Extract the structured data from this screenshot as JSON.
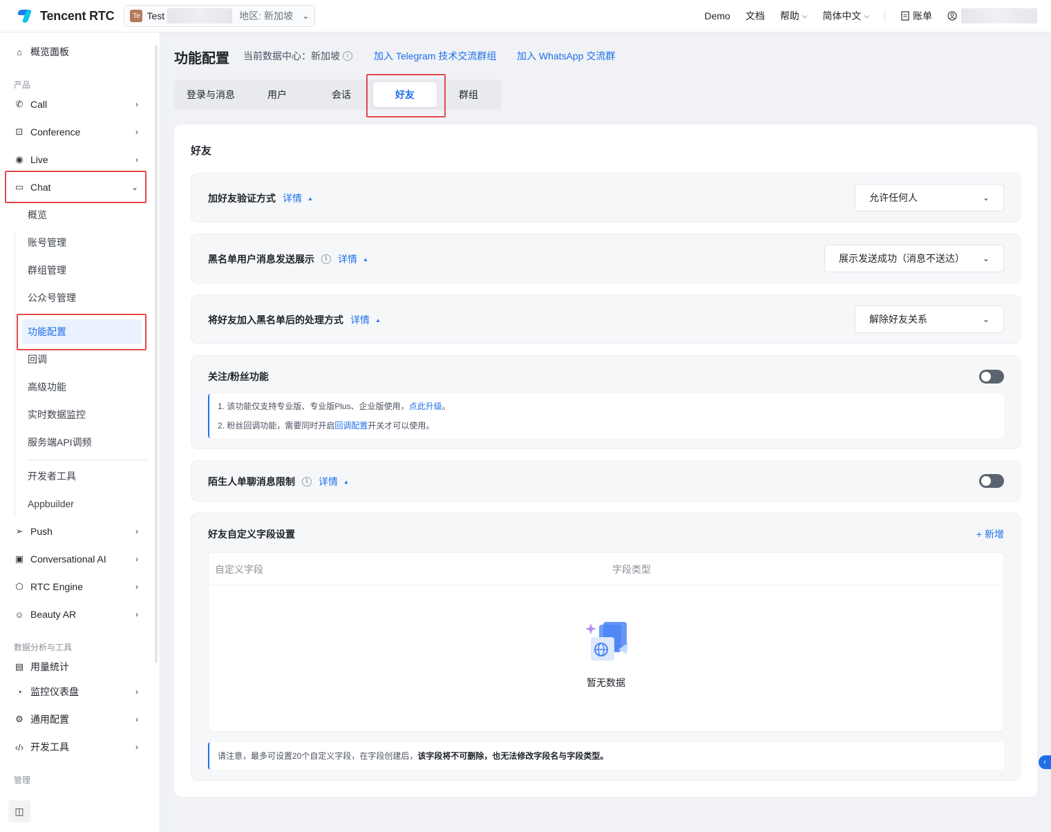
{
  "topbar": {
    "brand": "Tencent RTC",
    "app_badge": "Te",
    "app_name": "Test",
    "app_region": "地区: 新加坡",
    "nav": {
      "demo": "Demo",
      "docs": "文档",
      "help": "帮助",
      "lang": "简体中文",
      "billing": "账单"
    }
  },
  "sidebar": {
    "overview": "概览面板",
    "group_products": "产品",
    "call": "Call",
    "conference": "Conference",
    "live": "Live",
    "chat": "Chat",
    "chat_sub": [
      "概览",
      "账号管理",
      "群组管理",
      "公众号管理",
      "功能配置",
      "回调",
      "高级功能",
      "实时数据监控",
      "服务端API调频",
      "开发者工具",
      "Appbuilder"
    ],
    "push": "Push",
    "conv_ai": "Conversational AI",
    "rtc_engine": "RTC Engine",
    "beauty_ar": "Beauty AR",
    "group_tools": "数据分析与工具",
    "usage": "用量统计",
    "monitor": "监控仪表盘",
    "general": "通用配置",
    "devtools": "开发工具",
    "group_manage": "管理"
  },
  "header": {
    "title": "功能配置",
    "dc_label": "当前数据中心：新加坡",
    "telegram_link": "加入 Telegram 技术交流群组",
    "whatsapp_link": "加入 WhatsApp 交流群"
  },
  "tabs": [
    "登录与消息",
    "用户",
    "会话",
    "好友",
    "群组"
  ],
  "active_tab": "好友",
  "section": {
    "title": "好友",
    "detail_label": "详情",
    "rows": {
      "verify": {
        "label": "加好友验证方式",
        "value": "允许任何人"
      },
      "blacklist_display": {
        "label": "黑名单用户消息发送展示",
        "value": "展示发送成功（消息不送达）"
      },
      "blacklist_action": {
        "label": "将好友加入黑名单后的处理方式",
        "value": "解除好友关系"
      },
      "follow": {
        "label": "关注/粉丝功能",
        "enabled": false,
        "note1_pre": "1. 该功能仅支持专业版、专业版Plus、企业版使用，",
        "note1_link": "点此升级",
        "note1_post": "。",
        "note2_pre": "2. 粉丝回调功能，需要同时开启",
        "note2_link": "回调配置",
        "note2_post": "开关才可以使用。"
      },
      "stranger": {
        "label": "陌生人单聊消息限制",
        "enabled": false
      },
      "custom_fields": {
        "label": "好友自定义字段设置",
        "add": "+ 新增",
        "col_field": "自定义字段",
        "col_type": "字段类型",
        "empty": "暂无数据",
        "notice_pre": "请注意，最多可设置20个自定义字段，在字段创建后，",
        "notice_bold": "该字段将不可删除，也无法修改字段名与字段类型。"
      }
    }
  },
  "colors": {
    "accent": "#1e6fe8",
    "highlight_box": "#e5484d"
  }
}
